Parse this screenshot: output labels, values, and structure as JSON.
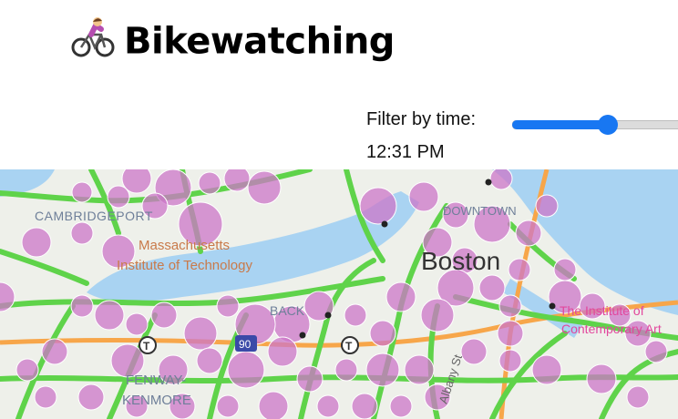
{
  "app": {
    "title": "Bikewatching",
    "icon": "person-biking-icon"
  },
  "filter": {
    "label": "Filter by time:",
    "time_display": "12:31 PM",
    "slider_fraction": 0.525,
    "accent_color": "#1877f2"
  },
  "map": {
    "labels": {
      "cambridgeport": "CAMBRIDGEPORT",
      "mit_line1": "Massachusetts",
      "mit_line2": "Institute of Technology",
      "boston": "Boston",
      "fenway_line1": "FENWAY-",
      "fenway_line2": "KENMORE",
      "downtown": "DOWNTOWN",
      "ica_line1": "The Institute of",
      "ica_line2": "Contemporary Art",
      "back_bay": "BACK",
      "highway": "90",
      "street": "Albany St"
    },
    "colors": {
      "water": "#a9d3f2",
      "land": "#eef0ea",
      "bike_lane": "#5fd34a",
      "highway": "#f7a64a",
      "station_marker": "#cc77c8"
    }
  }
}
